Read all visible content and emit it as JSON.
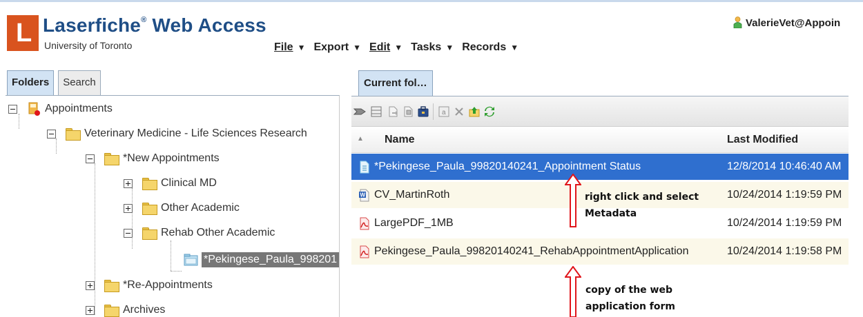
{
  "app": {
    "brand": "Laserfiche",
    "brand_mark": "®",
    "brand_suffix": " Web Access",
    "logo_letter": "L",
    "org": "University of Toronto",
    "user": "ValerieVet@Appoin"
  },
  "menu": [
    {
      "label": "File",
      "arrow": "▼"
    },
    {
      "label": "Export",
      "arrow": "▼"
    },
    {
      "label": "Edit",
      "arrow": "▼"
    },
    {
      "label": "Tasks",
      "arrow": "▼"
    },
    {
      "label": "Records",
      "arrow": "▼"
    }
  ],
  "left_tabs": {
    "folders": "Folders",
    "search": "Search"
  },
  "tree": {
    "root": "Appointments",
    "vet": "Veterinary Medicine - Life Sciences Research",
    "new_appts": "*New Appointments",
    "clinical": "Clinical MD",
    "other_academic": "Other Academic",
    "rehab_other": "Rehab Other Academic",
    "pekingese": "*Pekingese_Paula_998201",
    "reappts": "*Re-Appointments",
    "archives": "Archives"
  },
  "right_tab": "Current fol…",
  "columns": {
    "sort_glyph": "▲",
    "name": "Name",
    "last_modified": "Last Modified"
  },
  "files": [
    {
      "name": "*Pekingese_Paula_99820140241_Appointment Status",
      "modified": "12/8/2014 10:46:40 AM",
      "icon": "metadata-doc-icon"
    },
    {
      "name": "CV_MartinRoth",
      "modified": "10/24/2014 1:19:59 PM",
      "icon": "word-doc-icon"
    },
    {
      "name": "LargePDF_1MB",
      "modified": "10/24/2014 1:19:59 PM",
      "icon": "pdf-icon"
    },
    {
      "name": "Pekingese_Paula_99820140241_RehabAppointmentApplication",
      "modified": "10/24/2014 1:19:58 PM",
      "icon": "pdf-icon"
    }
  ],
  "annotations": {
    "note1_line1": "right click and select",
    "note1_line2": "Metadata",
    "note2_line1": "copy of the web",
    "note2_line2": "application form"
  },
  "colors": {
    "logo": "#d9531e",
    "brand": "#1f4e86",
    "selection": "#2f6fcf",
    "tree_selection": "#777777",
    "arrow": "#e0151b"
  }
}
